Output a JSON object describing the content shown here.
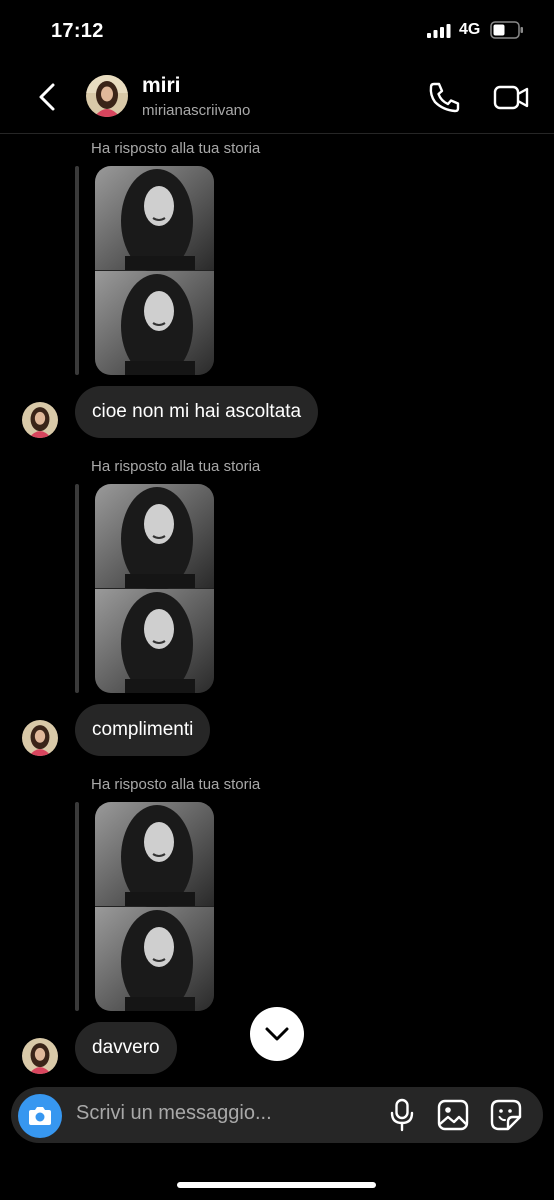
{
  "status_bar": {
    "time": "17:12",
    "network": "4G"
  },
  "header": {
    "name": "miri",
    "username": "mirianascriivano"
  },
  "messages": [
    {
      "reply_label": "Ha risposto alla tua storia",
      "text": "cioe non mi hai ascoltata"
    },
    {
      "reply_label": "Ha risposto alla tua storia",
      "text": "complimenti"
    },
    {
      "reply_label": "Ha risposto alla tua storia",
      "text": "davvero"
    }
  ],
  "composer": {
    "placeholder": "Scrivi un messaggio..."
  },
  "colors": {
    "background": "#000000",
    "bubble": "#262626",
    "camera_button": "#3797f0",
    "secondary_text": "#a8a8a8"
  },
  "icons": [
    "signal-icon",
    "battery-icon",
    "back-icon",
    "phone-icon",
    "video-camera-icon",
    "chevron-down-icon",
    "camera-icon",
    "microphone-icon",
    "gallery-icon",
    "sticker-icon"
  ]
}
